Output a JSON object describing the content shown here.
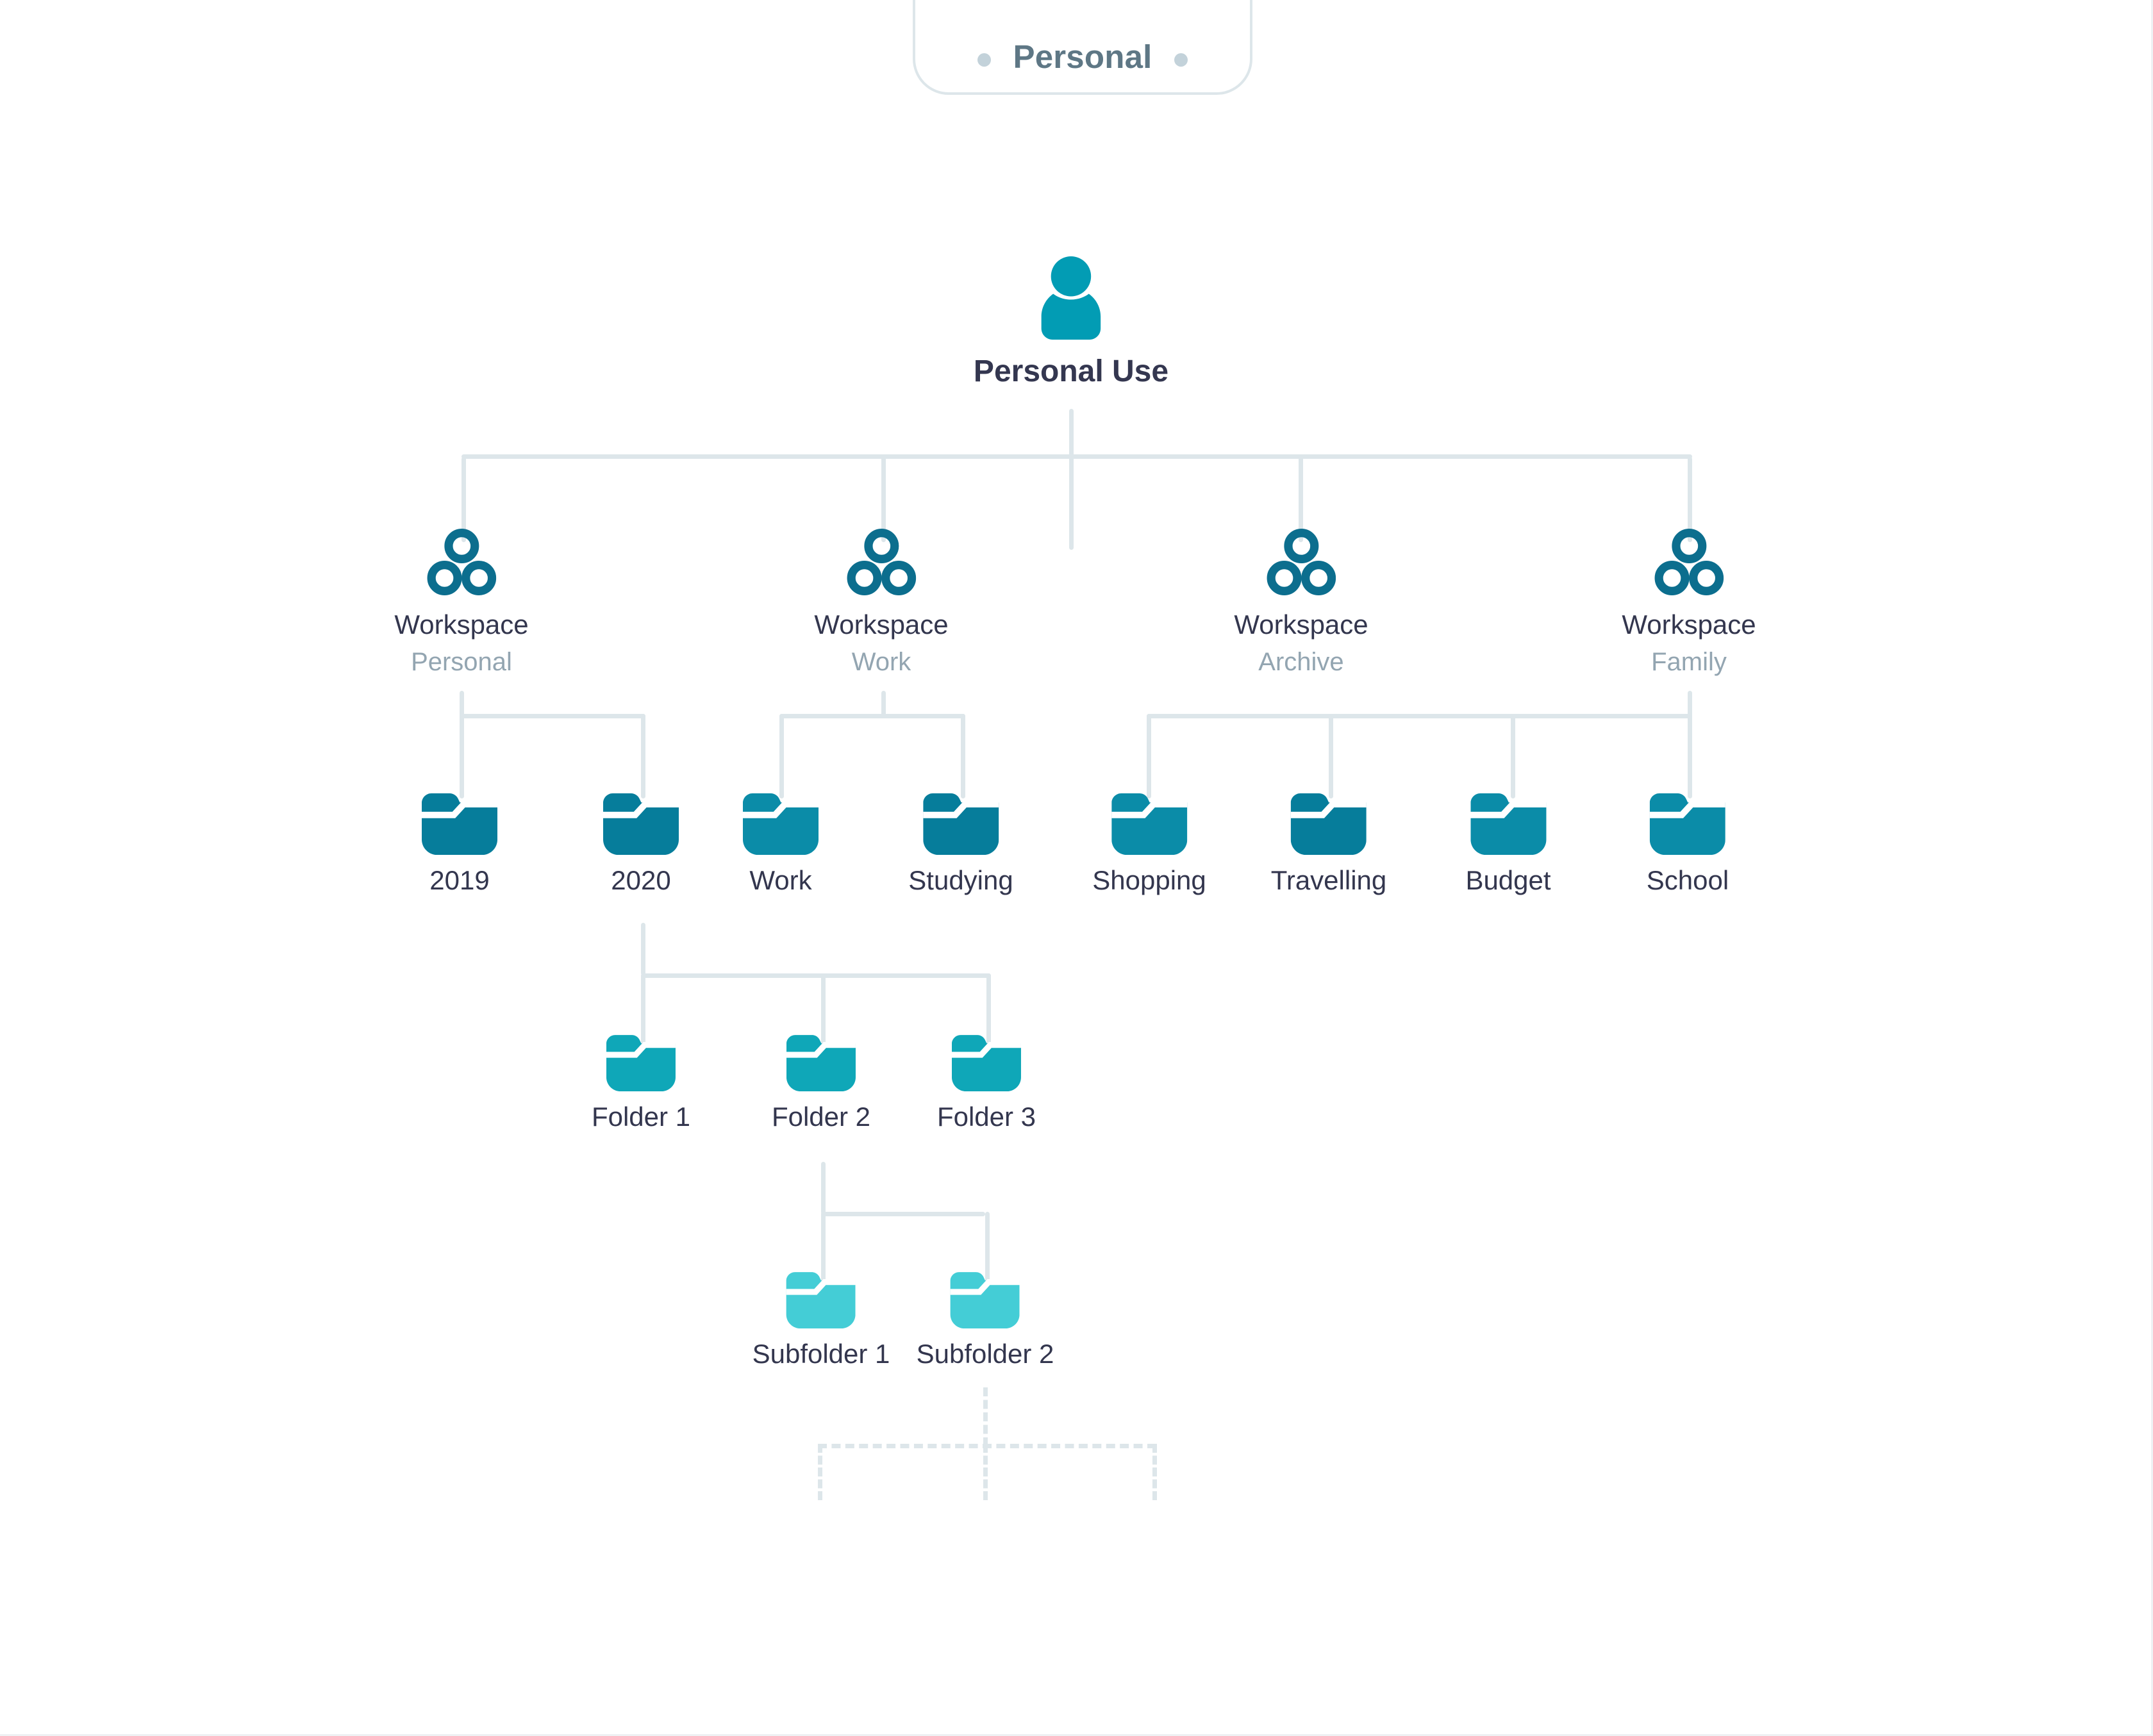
{
  "tab": {
    "label": "Personal",
    "left_dot": "dot-icon",
    "right_dot": "dot-icon"
  },
  "colors": {
    "root_icon": "#029cb4",
    "workspace_icon": "#0c6e8e",
    "folder_level2": "#067d9b",
    "folder_level3": "#0fa7b8",
    "folder_level4": "#44cdd6",
    "connector": "#dde6ea",
    "label_dark": "#33364e",
    "label_muted": "#93a5b1",
    "tab_text": "#5e7785",
    "tab_border": "#dde6ea"
  },
  "tree": {
    "root": {
      "icon": "person-icon",
      "label": "Personal Use"
    },
    "workspaces": [
      {
        "icon": "workspace-icon",
        "label": "Workspace",
        "sublabel": "Personal"
      },
      {
        "icon": "workspace-icon",
        "label": "Workspace",
        "sublabel": "Work"
      },
      {
        "icon": "workspace-icon",
        "label": "Workspace",
        "sublabel": "Archive"
      },
      {
        "icon": "workspace-icon",
        "label": "Workspace",
        "sublabel": "Family"
      }
    ],
    "folders": [
      {
        "icon": "folder-icon",
        "label": "2019"
      },
      {
        "icon": "folder-icon",
        "label": "2020"
      },
      {
        "icon": "folder-icon",
        "label": "Work"
      },
      {
        "icon": "folder-icon",
        "label": "Studying"
      },
      {
        "icon": "folder-icon",
        "label": "Shopping"
      },
      {
        "icon": "folder-icon",
        "label": "Travelling"
      },
      {
        "icon": "folder-icon",
        "label": "Budget"
      },
      {
        "icon": "folder-icon",
        "label": "School"
      }
    ],
    "subfolders_level3": [
      {
        "icon": "folder-icon",
        "label": "Folder 1"
      },
      {
        "icon": "folder-icon",
        "label": "Folder 2"
      },
      {
        "icon": "folder-icon",
        "label": "Folder 3"
      }
    ],
    "subfolders_level4": [
      {
        "icon": "folder-icon",
        "label": "Subfolder 1"
      },
      {
        "icon": "folder-icon",
        "label": "Subfolder 2"
      }
    ]
  }
}
